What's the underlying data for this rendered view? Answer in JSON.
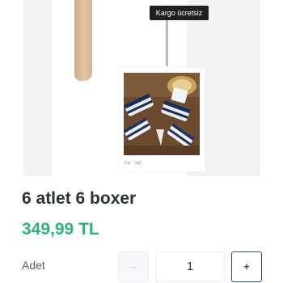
{
  "gallery": {
    "shipping_badge": "Kargo ücretsiz",
    "inner_caption_prefix": "Dür · 2",
    "inner_caption_dot": "●",
    "inner_caption_suffix": "5"
  },
  "product": {
    "title": "6 atlet 6 boxer",
    "price": "349,99 TL"
  },
  "quantity": {
    "label": "Adet",
    "value": "1",
    "decrement_label": "–",
    "increment_label": "+"
  },
  "colors": {
    "price": "#2db37a",
    "accent": "#2c4a87",
    "badge_bg": "#1f1f1f"
  },
  "icons": {
    "decrement": "minus-icon",
    "increment": "plus-icon"
  }
}
